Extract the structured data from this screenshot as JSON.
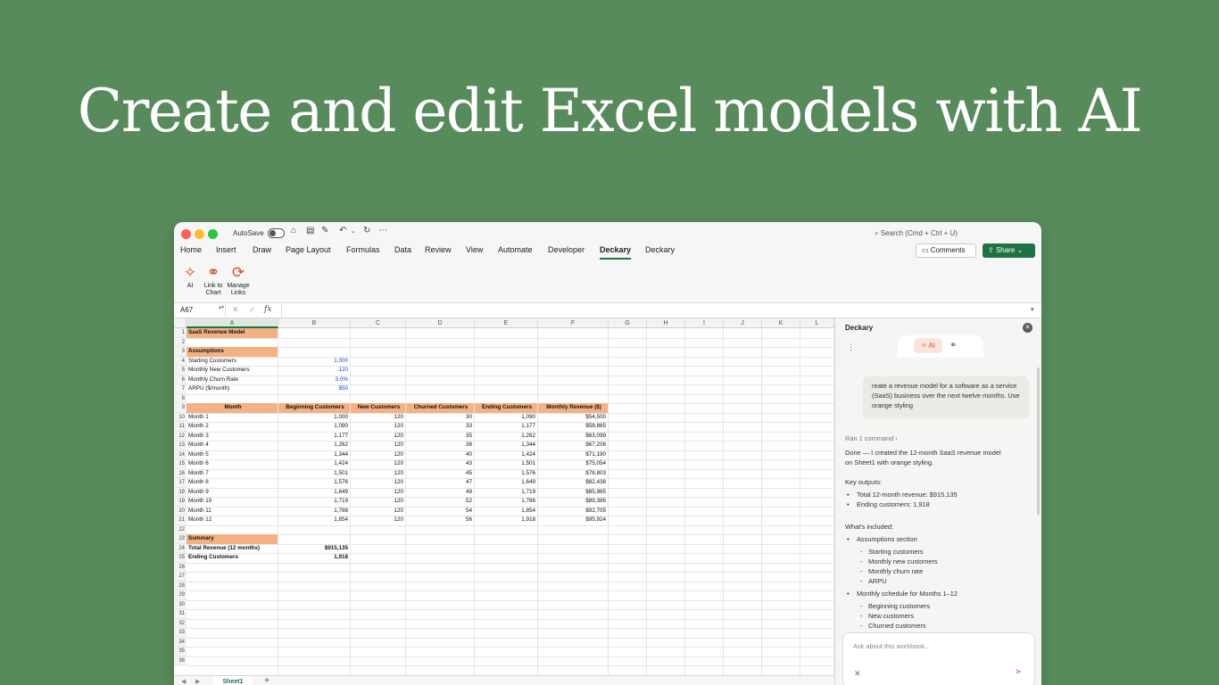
{
  "headline": "Create and edit Excel models with AI",
  "titlebar": {
    "autosave_label": "AutoSave",
    "search_placeholder": "Search (Cmd + Ctrl + U)"
  },
  "ribbon_tabs": [
    "Home",
    "Insert",
    "Draw",
    "Page Layout",
    "Formulas",
    "Data",
    "Review",
    "View",
    "Automate",
    "Developer",
    "Deckary",
    "Deckary"
  ],
  "active_tab": "Deckary",
  "comments_label": "Comments",
  "share_label": "Share",
  "ribbon_buttons": {
    "ai": "AI",
    "link_chart_1": "Link to",
    "link_chart_2": "Chart",
    "manage_links_1": "Manage",
    "manage_links_2": "Links"
  },
  "formula_bar": {
    "name_box": "A67",
    "fx": "fx"
  },
  "columns": [
    "A",
    "B",
    "C",
    "D",
    "E",
    "F",
    "G",
    "H",
    "I",
    "J",
    "K",
    "L"
  ],
  "selected_column": "A",
  "rows": [
    "1",
    "2",
    "3",
    "4",
    "5",
    "6",
    "7",
    "8",
    "9",
    "10",
    "11",
    "12",
    "13",
    "14",
    "15",
    "16",
    "17",
    "18",
    "19",
    "20",
    "21",
    "22",
    "23",
    "24",
    "25",
    "26",
    "27",
    "28",
    "29",
    "30",
    "31",
    "32",
    "33",
    "34",
    "35",
    "36"
  ],
  "sheet": {
    "title": "SaaS Revenue Model",
    "assumptions_header": "Assumptions",
    "assumptions": [
      {
        "label": "Starting Customers",
        "value": "1,000"
      },
      {
        "label": "Monthly New Customers",
        "value": "120"
      },
      {
        "label": "Monthly Churn Rate",
        "value": "3.0%"
      },
      {
        "label": "ARPU ($/month)",
        "value": "$50"
      }
    ],
    "table_headers": [
      "Month",
      "Beginning Customers",
      "New Customers",
      "Churned Customers",
      "Ending Customers",
      "Monthly Revenue ($)"
    ],
    "table_rows": [
      [
        "Month 1",
        "1,000",
        "120",
        "30",
        "1,090",
        "$54,500"
      ],
      [
        "Month 2",
        "1,090",
        "120",
        "33",
        "1,177",
        "$58,865"
      ],
      [
        "Month 3",
        "1,177",
        "120",
        "35",
        "1,262",
        "$63,099"
      ],
      [
        "Month 4",
        "1,262",
        "120",
        "38",
        "1,344",
        "$67,206"
      ],
      [
        "Month 5",
        "1,344",
        "120",
        "40",
        "1,424",
        "$71,190"
      ],
      [
        "Month 6",
        "1,424",
        "120",
        "43",
        "1,501",
        "$75,054"
      ],
      [
        "Month 7",
        "1,501",
        "120",
        "45",
        "1,576",
        "$78,803"
      ],
      [
        "Month 8",
        "1,576",
        "120",
        "47",
        "1,649",
        "$82,438"
      ],
      [
        "Month 9",
        "1,649",
        "120",
        "49",
        "1,719",
        "$85,965"
      ],
      [
        "Month 10",
        "1,719",
        "120",
        "52",
        "1,788",
        "$89,386"
      ],
      [
        "Month 11",
        "1,788",
        "120",
        "54",
        "1,854",
        "$92,705"
      ],
      [
        "Month 12",
        "1,854",
        "120",
        "56",
        "1,918",
        "$95,924"
      ]
    ],
    "summary_header": "Summary",
    "summary": [
      {
        "label": "Total Revenue (12 months)",
        "value": "$915,135"
      },
      {
        "label": "Ending Customers",
        "value": "1,918"
      }
    ]
  },
  "sheet_tab": "Sheet1",
  "panel": {
    "title": "Deckary",
    "ai_label": "AI",
    "user_message": "reate a revenue model for a software as a service (SaaS) business over the next twelve months. Use orange styling",
    "ran_command": "Ran 1 command",
    "done_text_1": "Done — I created the 12-month SaaS revenue model",
    "done_text_2": "on Sheet1 with orange styling.",
    "key_outputs_title": "Key outputs:",
    "key_outputs": [
      "Total 12-month revenue: $915,135",
      "Ending customers: 1,918"
    ],
    "included_title": "What's included:",
    "included_1": "Assumptions section",
    "included_1_items": [
      "Starting customers",
      "Monthly new customers",
      "Monthly churn rate",
      "ARPU"
    ],
    "included_2": "Monthly schedule for Months 1–12",
    "included_2_items": [
      "Beginning customers",
      "New customers",
      "Churned customers"
    ],
    "input_placeholder": "Ask about this workbook..."
  },
  "colors": {
    "background": "#588b5c",
    "excel_green": "#1f7244",
    "orange_fill": "#f4b183",
    "deckary_accent": "#d2512a"
  }
}
